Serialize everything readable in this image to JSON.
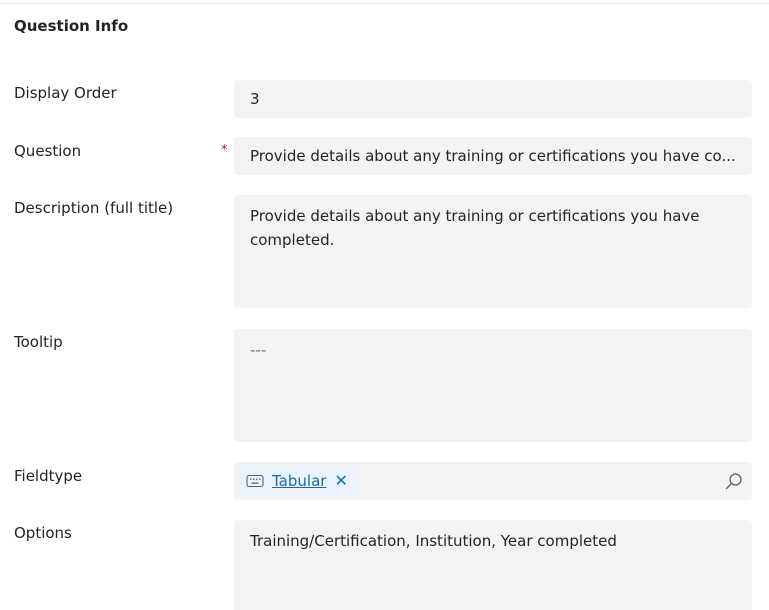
{
  "section": {
    "title": "Question Info"
  },
  "fields": {
    "display_order": {
      "label": "Display Order",
      "value": "3"
    },
    "question": {
      "label": "Question",
      "required_mark": "*",
      "value": "Provide details about any training or certifications you have co..."
    },
    "description": {
      "label": "Description (full title)",
      "value": "Provide details about any training or certifications you have completed."
    },
    "tooltip": {
      "label": "Tooltip",
      "value": "---"
    },
    "fieldtype": {
      "label": "Fieldtype",
      "tag_label": "Tabular",
      "tag_remove": "✕",
      "tag_icon": "keyboard-icon",
      "search_icon": "search-icon"
    },
    "options": {
      "label": "Options",
      "value": "Training/Certification, Institution, Year completed"
    }
  },
  "colors": {
    "field_bg": "#f3f3f3",
    "link": "#0f6cbd",
    "required": "#a4262c",
    "tag_bg": "#ebf3fc"
  }
}
